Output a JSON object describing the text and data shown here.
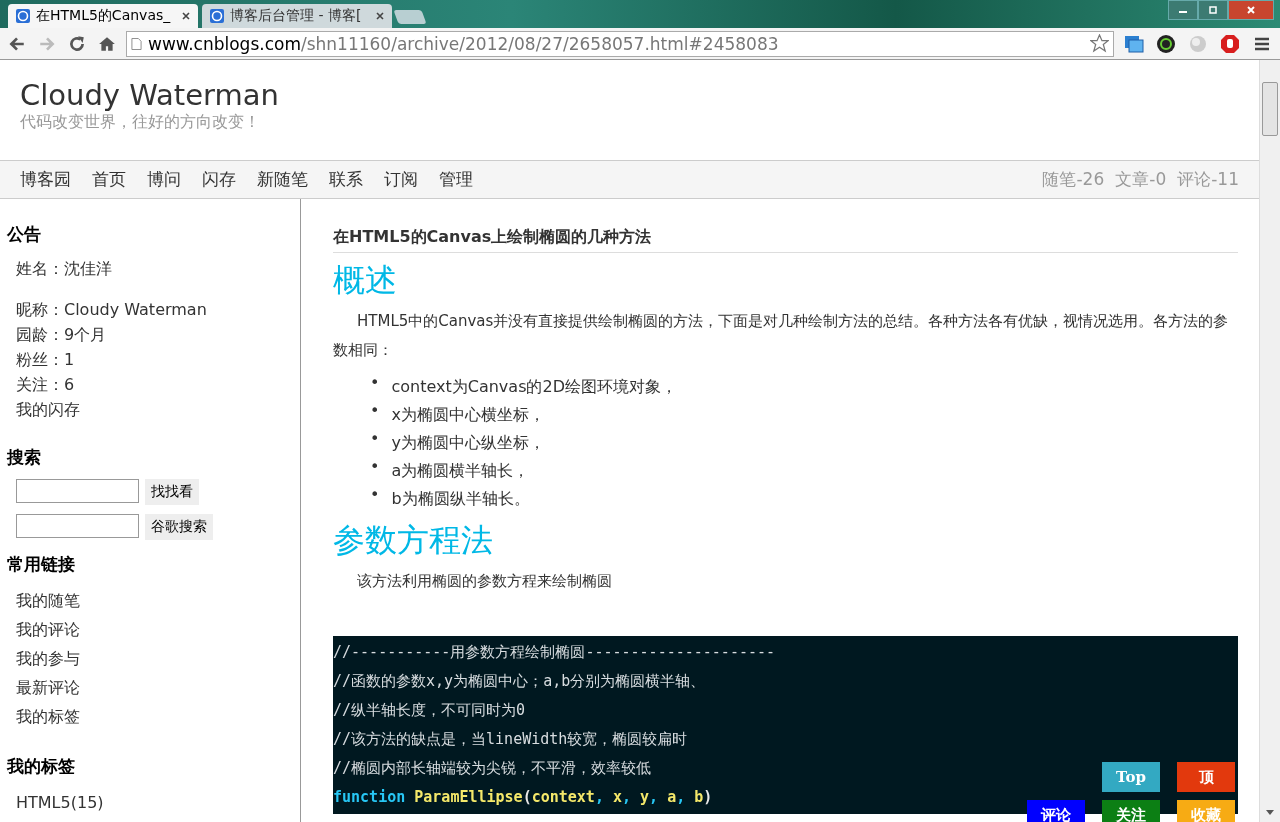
{
  "browser": {
    "tabs": [
      {
        "title": "在HTML5的Canvas_",
        "selected": true
      },
      {
        "title": "博客后台管理 - 博客[",
        "selected": false
      }
    ],
    "url": {
      "host": "www.cnblogs.com",
      "path": "/shn11160/archive/2012/08/27/2658057.html#2458083"
    }
  },
  "blog": {
    "title": "Cloudy Waterman",
    "subtitle": "代码改变世界，往好的方向改变！"
  },
  "nav": {
    "items": [
      "博客园",
      "首页",
      "博问",
      "闪存",
      "新随笔",
      "联系",
      "订阅",
      "管理"
    ],
    "stats": [
      "随笔-26",
      "文章-0",
      "评论-11"
    ]
  },
  "sidebar": {
    "notice": {
      "heading": "公告",
      "name": "姓名：沈佳洋",
      "lines": [
        "昵称：Cloudy Waterman",
        "园龄：9个月",
        "粉丝：1",
        "关注：6",
        "我的闪存"
      ]
    },
    "search": {
      "heading": "搜索",
      "buttons": [
        "找找看",
        "谷歌搜索"
      ]
    },
    "links": {
      "heading": "常用链接",
      "items": [
        "我的随笔",
        "我的评论",
        "我的参与",
        "最新评论",
        "我的标签"
      ]
    },
    "tags": {
      "heading": "我的标签",
      "items": [
        "HTML5(15)"
      ]
    }
  },
  "post": {
    "title": "在**HTML5**的**Canvas**上绘制椭圆的几种方法",
    "sections": [
      {
        "heading": "概述",
        "paragraph": "HTML5中的Canvas并没有直接提供绘制椭圆的方法，下面是对几种绘制方法的总结。各种方法各有优缺，视情况选用。各方法的参数相同：",
        "bullet_mark": "•",
        "bullets": [
          "context为Canvas的2D绘图环境对象，",
          "x为椭圆中心横坐标，",
          "y为椭圆中心纵坐标，",
          "a为椭圆横半轴长，",
          "b为椭圆纵半轴长。"
        ]
      },
      {
        "heading": "参数方程法",
        "paragraph": "该方法利用椭圆的参数方程来绘制椭圆"
      }
    ],
    "code": [
      [
        {
          "kind": "comment",
          "text": "//-----------用参数方程绘制椭圆---------------------"
        }
      ],
      [
        {
          "kind": "comment",
          "text": "//函数的参数x,y为椭圆中心；a,b分别为椭圆横半轴、"
        }
      ],
      [
        {
          "kind": "comment",
          "text": "//纵半轴长度，不可同时为0"
        }
      ],
      [
        {
          "kind": "comment",
          "text": "//该方法的缺点是，当lineWidth较宽，椭圆较扁时"
        }
      ],
      [
        {
          "kind": "comment",
          "text": "//椭圆内部长轴端较为尖锐，不平滑，效率较低"
        }
      ],
      [
        {
          "kind": "keyword",
          "text": "function "
        },
        {
          "kind": "name",
          "text": "ParamEllipse"
        },
        {
          "kind": "plain",
          "text": "("
        },
        {
          "kind": "name",
          "text": "context"
        },
        {
          "kind": "punct",
          "text": ", "
        },
        {
          "kind": "name",
          "text": "x"
        },
        {
          "kind": "punct",
          "text": ", "
        },
        {
          "kind": "name",
          "text": "y"
        },
        {
          "kind": "punct",
          "text": ", "
        },
        {
          "kind": "name",
          "text": "a"
        },
        {
          "kind": "punct",
          "text": ", "
        },
        {
          "kind": "name",
          "text": "b"
        },
        {
          "kind": "plain",
          "text": ")"
        }
      ]
    ]
  },
  "float_buttons": [
    [
      {
        "label": "Top",
        "color": "#33a9c2"
      },
      {
        "label": "顶",
        "color": "#e2390d"
      }
    ],
    [
      {
        "label": "评论",
        "color": "#0000ff"
      },
      {
        "label": "关注",
        "color": "#0c7f14"
      },
      {
        "label": "收藏",
        "color": "#f7ab14"
      }
    ]
  ]
}
